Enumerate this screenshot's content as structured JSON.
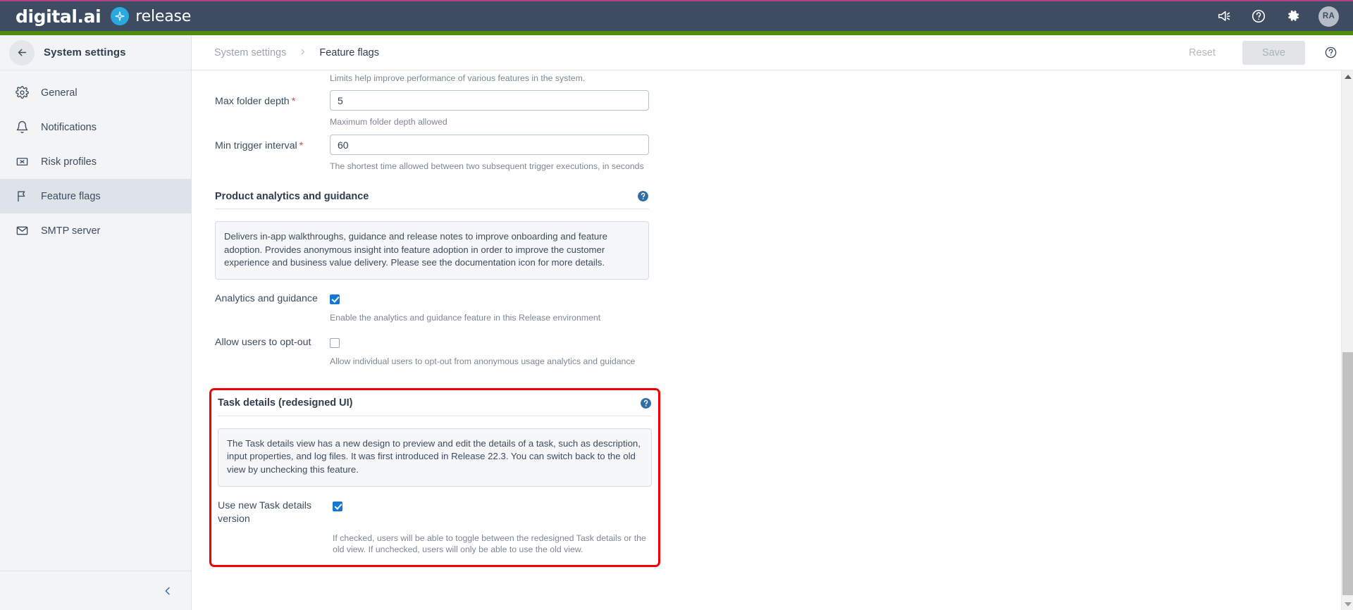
{
  "topbar": {
    "brand_primary": "digital.ai",
    "brand_secondary": "release",
    "icons": [
      "megaphone-icon",
      "help-icon",
      "gear-icon"
    ],
    "avatar_initials": "RA",
    "background": "#3d4c60",
    "accent_top": "#b0437f",
    "accent_bar": "#4d8c10"
  },
  "sidebar": {
    "title": "System settings",
    "back_icon": "arrow-left-icon",
    "collapse_icon": "chevron-left-icon",
    "items": [
      {
        "label": "General",
        "icon": "gear-icon",
        "active": false
      },
      {
        "label": "Notifications",
        "icon": "bell-icon",
        "active": false
      },
      {
        "label": "Risk profiles",
        "icon": "risk-profile-icon",
        "active": false
      },
      {
        "label": "Feature flags",
        "icon": "flag-icon",
        "active": true
      },
      {
        "label": "SMTP server",
        "icon": "envelope-icon",
        "active": false
      }
    ]
  },
  "header": {
    "breadcrumb_parent": "System settings",
    "breadcrumb_separator": "›",
    "breadcrumb_current": "Feature flags",
    "reset_label": "Reset",
    "save_label": "Save",
    "reset_disabled": true,
    "save_disabled": true,
    "help_icon": "help-circle-icon"
  },
  "form": {
    "limits_helper": "Limits help improve performance of various features in the system.",
    "fields": [
      {
        "label": "Max folder depth",
        "required": true,
        "value": "5",
        "help": "Maximum folder depth allowed"
      },
      {
        "label": "Min trigger interval",
        "required": true,
        "value": "60",
        "help": "The shortest time allowed between two subsequent trigger executions, in seconds"
      }
    ],
    "analytics_section": {
      "title": "Product analytics and guidance",
      "help_icon": "help-circle-filled-icon",
      "info": "Delivers in-app walkthroughs, guidance and release notes to improve onboarding and feature adoption. Provides anonymous insight into feature adoption in order to improve the customer experience and business value delivery. Please see the documentation icon for more details.",
      "checkboxes": [
        {
          "label": "Analytics and guidance",
          "checked": true,
          "help": "Enable the analytics and guidance feature in this Release environment"
        },
        {
          "label": "Allow users to opt-out",
          "checked": false,
          "help": "Allow individual users to opt-out from anonymous usage analytics and guidance"
        }
      ]
    },
    "task_details_section": {
      "title": "Task details (redesigned UI)",
      "help_icon": "help-circle-filled-icon",
      "highlighted": true,
      "highlight_color": "#f40000",
      "info": "The Task details view has a new design to preview and edit the details of a task, such as description, input properties, and log files. It was first introduced in Release 22.3. You can switch back to the old view by unchecking this feature.",
      "checkbox": {
        "label": "Use new Task details version",
        "checked": true,
        "help": "If checked, users will be able to toggle between the redesigned Task details or the old view. If unchecked, users will only be able to use the old view."
      }
    }
  },
  "scrollbar": {
    "up_icon": "triangle-up-icon",
    "down_icon": "triangle-down-icon"
  }
}
